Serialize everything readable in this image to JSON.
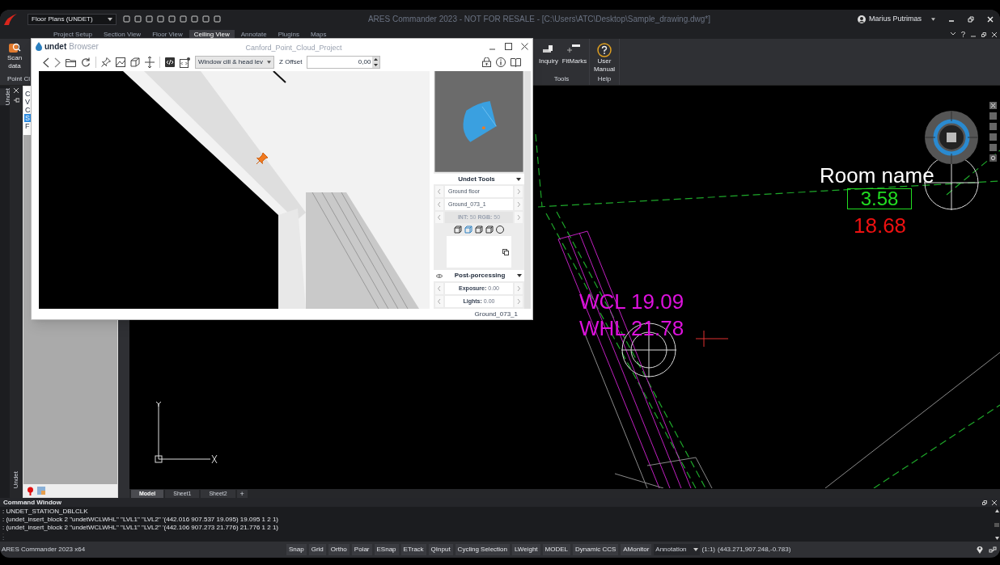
{
  "title_bar": {
    "workspace": "Floor Plans (UNDET)",
    "title": "ARES Commander 2023 - NOT FOR RESALE - [C:\\Users\\ATC\\Desktop\\Sample_drawing.dwg*]",
    "user": "Marius Putrimas"
  },
  "ribbon_tabs": [
    {
      "label": "Project Setup",
      "selected": false
    },
    {
      "label": "Section View",
      "selected": false
    },
    {
      "label": "Floor View",
      "selected": false
    },
    {
      "label": "Ceiling View",
      "selected": true
    },
    {
      "label": "Annotate",
      "selected": false
    },
    {
      "label": "Plugins",
      "selected": false
    },
    {
      "label": "Maps",
      "selected": false
    }
  ],
  "ribbon": {
    "scan_button": "Scan data",
    "left_panel_label": "Point Cl",
    "groups": [
      {
        "label": "Tools",
        "buttons": [
          {
            "label": "Inquiry",
            "kind": "inquiry"
          },
          {
            "label": "FitMarks",
            "kind": "fitmarks"
          }
        ]
      },
      {
        "label": "Help",
        "buttons": [
          {
            "label": "User Manual",
            "kind": "help"
          }
        ]
      }
    ]
  },
  "side_panel": {
    "tab": "Undet",
    "bottom_tab": "Undet",
    "items": [
      {
        "label": "C",
        "selected": false
      },
      {
        "label": "V",
        "selected": false
      },
      {
        "label": "C",
        "selected": false
      },
      {
        "label": "S",
        "selected": true
      },
      {
        "label": "F",
        "selected": false
      }
    ]
  },
  "undet_window": {
    "brand": "undet",
    "subtitle": "Browser",
    "title": "Canford_Point_Cloud_Project",
    "layer_dropdown": "Window cill & head lev",
    "z_offset_label": "Z Offset",
    "z_offset_value": "0,00",
    "tools_header": "Undet Tools",
    "rows": [
      {
        "text": "Ground floor",
        "disabled": false
      },
      {
        "text": "Ground_073_1",
        "disabled": false
      },
      {
        "text": "**INT:** 50 **RGB:** 50",
        "disabled": true
      }
    ],
    "post_header": "Post-porcessing",
    "post_rows": [
      {
        "label": "Exposure:",
        "value": "0.00"
      },
      {
        "label": "Lights:",
        "value": "0.00"
      }
    ],
    "footer": "Ground_073_1"
  },
  "canvas": {
    "labels": [
      {
        "text": "Room name",
        "kind": "plain",
        "color": "#ffffff"
      },
      {
        "text": "3.58",
        "kind": "boxed",
        "color": "#22dd22"
      },
      {
        "text": "18.68",
        "kind": "plain",
        "color": "#ee1111"
      },
      {
        "text": "WCL 19.09",
        "kind": "plain",
        "color": "#dd11dd"
      },
      {
        "text": "WHL 21.78",
        "kind": "plain",
        "color": "#dd11dd"
      }
    ]
  },
  "sheet_tabs": [
    {
      "label": "Model",
      "selected": true
    },
    {
      "label": "Sheet1",
      "selected": false
    },
    {
      "label": "Sheet2",
      "selected": false
    }
  ],
  "add_sheet": "+",
  "command_window": {
    "title": "Command Window",
    "lines": [
      ": UNDET_STATION_DBLCLK",
      ": (undet_insert_block 2 \"undetWCLWHL\" \"LVL1\" \"LVL2\" '(442.016 907.537 19.095) 19.095 1 2 1)",
      ": (undet_insert_block 2 \"undetWCLWHL\" \"LVL1\" \"LVL2\" '(442.106 907.273 21.776) 21.776 1 2 1)"
    ],
    "prompt": ":"
  },
  "status_bar": {
    "app": "ARES Commander 2023 x64",
    "toggles": [
      "Snap",
      "Grid",
      "Ortho",
      "Polar",
      "ESnap",
      "ETrack",
      "QInput",
      "Cycling Selection",
      "LWeight",
      "MODEL",
      "Dynamic CCS",
      "AMonitor"
    ],
    "annotation": "Annotation",
    "scale": "(1:1)",
    "coords": "(443.271,907.248,-0.783)"
  }
}
